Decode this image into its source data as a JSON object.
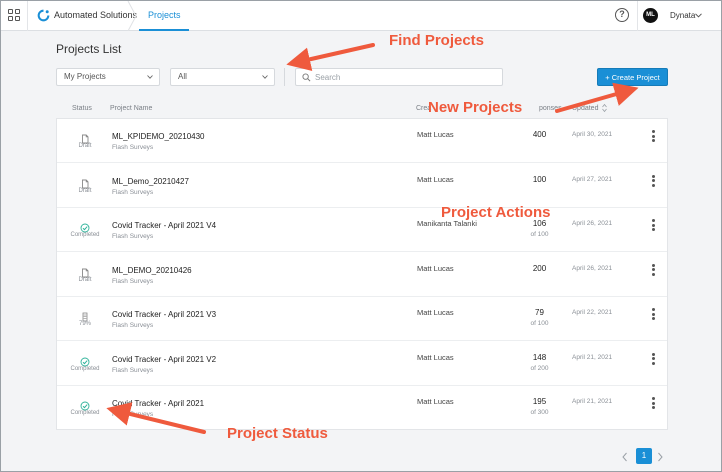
{
  "topbar": {
    "org_name": "Automated Solutions",
    "active_tab": "Projects",
    "avatar_initials": "ML",
    "account_name": "Dynata",
    "help_symbol": "?"
  },
  "page": {
    "title": "Projects List",
    "filters": {
      "owner_value": "My Projects",
      "status_value": "All"
    },
    "search": {
      "placeholder": "Search",
      "value": ""
    },
    "create_label": "+ Create Project"
  },
  "table": {
    "headers": {
      "status": "Status",
      "name": "Project Name",
      "creator": "Crea",
      "responses": "ponses",
      "updated": "Updated"
    },
    "rows": [
      {
        "status_icon": "draft-icon",
        "status": "Draft",
        "name": "ML_KPIDEMO_20210430",
        "type": "Flash Surveys",
        "creator": "Matt Lucas",
        "responses": "400",
        "responses_of": "",
        "date": "April 30, 2021"
      },
      {
        "status_icon": "draft-icon",
        "status": "Draft",
        "name": "ML_Demo_20210427",
        "type": "Flash Surveys",
        "creator": "Matt Lucas",
        "responses": "100",
        "responses_of": "",
        "date": "April 27, 2021"
      },
      {
        "status_icon": "completed-icon",
        "status": "Completed",
        "name": "Covid Tracker - April 2021 V4",
        "type": "Flash Surveys",
        "creator": "Manikanta Talanki",
        "responses": "106",
        "responses_of": "of 100",
        "date": "April 26, 2021"
      },
      {
        "status_icon": "draft-icon",
        "status": "Draft",
        "name": "ML_DEMO_20210426",
        "type": "Flash Surveys",
        "creator": "Matt Lucas",
        "responses": "200",
        "responses_of": "",
        "date": "April 26, 2021"
      },
      {
        "status_icon": "progress-icon",
        "status": "79%",
        "name": "Covid Tracker - April 2021 V3",
        "type": "Flash Surveys",
        "creator": "Matt Lucas",
        "responses": "79",
        "responses_of": "of 100",
        "date": "April 22, 2021"
      },
      {
        "status_icon": "completed-icon",
        "status": "Completed",
        "name": "Covid Tracker - April 2021 V2",
        "type": "Flash Surveys",
        "creator": "Matt Lucas",
        "responses": "148",
        "responses_of": "of 200",
        "date": "April 21, 2021"
      },
      {
        "status_icon": "completed-icon",
        "status": "Completed",
        "name": "Covid Tracker - April 2021",
        "type": "Flash Surveys",
        "creator": "Matt Lucas",
        "responses": "195",
        "responses_of": "of 300",
        "date": "April 21, 2021"
      }
    ]
  },
  "pagination": {
    "current_page": "1"
  },
  "annotations": {
    "find_projects": "Find Projects",
    "new_projects": "New Projects",
    "project_actions": "Project Actions",
    "project_status": "Project Status"
  },
  "colors": {
    "accent": "#1a8fd6",
    "annotation": "#ef5a3d",
    "completed": "#2fb39a"
  }
}
